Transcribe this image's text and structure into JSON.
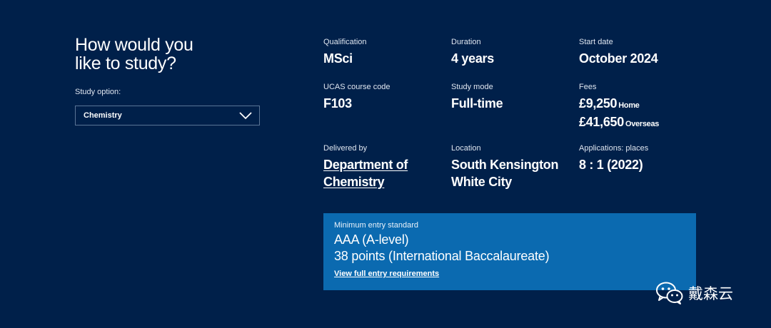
{
  "study": {
    "heading_line1": "How would you",
    "heading_line2": "like to study?",
    "option_label": "Study option:",
    "option_value": "Chemistry"
  },
  "details": {
    "qualification": {
      "label": "Qualification",
      "value": "MSci"
    },
    "duration": {
      "label": "Duration",
      "value": "4 years"
    },
    "start_date": {
      "label": "Start date",
      "value": "October 2024"
    },
    "ucas": {
      "label": "UCAS course code",
      "value": "F103"
    },
    "study_mode": {
      "label": "Study mode",
      "value": "Full-time"
    },
    "fees": {
      "label": "Fees",
      "home_amount": "£9,250",
      "home_tag": "Home",
      "overseas_amount": "£41,650",
      "overseas_tag": "Overseas"
    },
    "delivered_by": {
      "label": "Delivered by",
      "line1": "Department of",
      "line2": "Chemistry"
    },
    "location": {
      "label": "Location",
      "line1": "South Kensington",
      "line2": "White City"
    },
    "applications": {
      "label": "Applications: places",
      "value": "8 : 1 (2022)"
    }
  },
  "entry": {
    "label": "Minimum entry standard",
    "line1": "AAA (A-level)",
    "line2": "38 points (International Baccalaureate)",
    "link": "View full entry requirements"
  },
  "watermark": {
    "text": "戴森云",
    "icon": "wechat-icon"
  }
}
